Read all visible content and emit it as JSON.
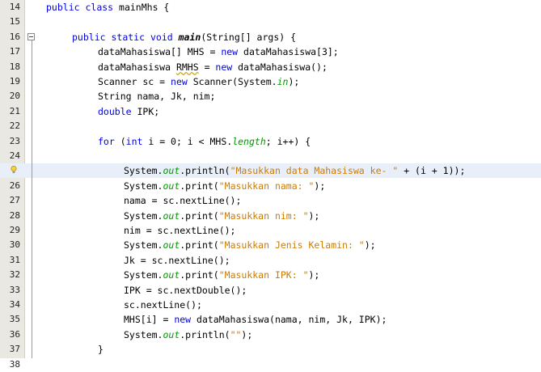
{
  "editor": {
    "lines": [
      {
        "n": "14",
        "indent": 0,
        "tokens": [
          {
            "t": "public",
            "c": "kw"
          },
          {
            "t": " "
          },
          {
            "t": "class",
            "c": "kw"
          },
          {
            "t": " mainMhs {"
          }
        ]
      },
      {
        "n": "15",
        "indent": 0,
        "tokens": []
      },
      {
        "n": "16",
        "indent": 1,
        "fold": true,
        "tokens": [
          {
            "t": "public",
            "c": "kw"
          },
          {
            "t": " "
          },
          {
            "t": "static",
            "c": "kw"
          },
          {
            "t": " "
          },
          {
            "t": "void",
            "c": "kw"
          },
          {
            "t": " "
          },
          {
            "t": "main",
            "c": "mth"
          },
          {
            "t": "(String[] args) {"
          }
        ]
      },
      {
        "n": "17",
        "indent": 2,
        "tokens": [
          {
            "t": "dataMahasiswa[] MHS = "
          },
          {
            "t": "new",
            "c": "kw"
          },
          {
            "t": " dataMahasiswa[3];"
          }
        ]
      },
      {
        "n": "18",
        "indent": 2,
        "tokens": [
          {
            "t": "dataMahasiswa "
          },
          {
            "t": "RMHS",
            "c": "warn"
          },
          {
            "t": " = "
          },
          {
            "t": "new",
            "c": "kw"
          },
          {
            "t": " dataMahasiswa();"
          }
        ]
      },
      {
        "n": "19",
        "indent": 2,
        "tokens": [
          {
            "t": "Scanner sc = "
          },
          {
            "t": "new",
            "c": "kw"
          },
          {
            "t": " Scanner(System."
          },
          {
            "t": "in",
            "c": "fld"
          },
          {
            "t": ");"
          }
        ]
      },
      {
        "n": "20",
        "indent": 2,
        "tokens": [
          {
            "t": "String nama, Jk, nim;"
          }
        ]
      },
      {
        "n": "21",
        "indent": 2,
        "tokens": [
          {
            "t": "double",
            "c": "kw"
          },
          {
            "t": " IPK;"
          }
        ]
      },
      {
        "n": "22",
        "indent": 0,
        "tokens": []
      },
      {
        "n": "23",
        "indent": 2,
        "tokens": [
          {
            "t": "for",
            "c": "kw"
          },
          {
            "t": " ("
          },
          {
            "t": "int",
            "c": "kw"
          },
          {
            "t": " i = 0; i < MHS."
          },
          {
            "t": "length",
            "c": "fld"
          },
          {
            "t": "; i++) {"
          }
        ]
      },
      {
        "n": "24",
        "indent": 0,
        "tokens": []
      },
      {
        "n": "25",
        "indent": 3,
        "highlight": true,
        "bulb": true,
        "tokens": [
          {
            "t": "System."
          },
          {
            "t": "out",
            "c": "fld"
          },
          {
            "t": ".println("
          },
          {
            "t": "\"Masukkan data Mahasiswa ke- \"",
            "c": "str"
          },
          {
            "t": " + (i + 1));"
          }
        ]
      },
      {
        "n": "26",
        "indent": 3,
        "tokens": [
          {
            "t": "System."
          },
          {
            "t": "out",
            "c": "fld"
          },
          {
            "t": ".print("
          },
          {
            "t": "\"Masukkan nama: \"",
            "c": "str"
          },
          {
            "t": ");"
          }
        ]
      },
      {
        "n": "27",
        "indent": 3,
        "tokens": [
          {
            "t": "nama = sc.nextLine();"
          }
        ]
      },
      {
        "n": "28",
        "indent": 3,
        "tokens": [
          {
            "t": "System."
          },
          {
            "t": "out",
            "c": "fld"
          },
          {
            "t": ".print("
          },
          {
            "t": "\"Masukkan nim: \"",
            "c": "str"
          },
          {
            "t": ");"
          }
        ]
      },
      {
        "n": "29",
        "indent": 3,
        "tokens": [
          {
            "t": "nim = sc.nextLine();"
          }
        ]
      },
      {
        "n": "30",
        "indent": 3,
        "tokens": [
          {
            "t": "System."
          },
          {
            "t": "out",
            "c": "fld"
          },
          {
            "t": ".print("
          },
          {
            "t": "\"Masukkan Jenis Kelamin: \"",
            "c": "str"
          },
          {
            "t": ");"
          }
        ]
      },
      {
        "n": "31",
        "indent": 3,
        "tokens": [
          {
            "t": "Jk = sc.nextLine();"
          }
        ]
      },
      {
        "n": "32",
        "indent": 3,
        "tokens": [
          {
            "t": "System."
          },
          {
            "t": "out",
            "c": "fld"
          },
          {
            "t": ".print("
          },
          {
            "t": "\"Masukkan IPK: \"",
            "c": "str"
          },
          {
            "t": ");"
          }
        ]
      },
      {
        "n": "33",
        "indent": 3,
        "tokens": [
          {
            "t": "IPK = sc.nextDouble();"
          }
        ]
      },
      {
        "n": "34",
        "indent": 3,
        "tokens": [
          {
            "t": "sc.nextLine();"
          }
        ]
      },
      {
        "n": "35",
        "indent": 3,
        "tokens": [
          {
            "t": "MHS[i] = "
          },
          {
            "t": "new",
            "c": "kw"
          },
          {
            "t": " dataMahasiswa(nama, nim, Jk, IPK);"
          }
        ]
      },
      {
        "n": "36",
        "indent": 3,
        "tokens": [
          {
            "t": "System."
          },
          {
            "t": "out",
            "c": "fld"
          },
          {
            "t": ".println("
          },
          {
            "t": "\"\"",
            "c": "str"
          },
          {
            "t": ");"
          }
        ]
      },
      {
        "n": "37",
        "indent": 2,
        "tokens": [
          {
            "t": "}"
          }
        ]
      },
      {
        "n": "38",
        "indent": 0,
        "tokens": []
      }
    ]
  },
  "colors": {
    "keyword": "#0000e6",
    "string": "#ce7b00",
    "field": "#009900",
    "highlight_line": "#e9eff8",
    "gutter": "#e9e8e2"
  },
  "icons": {
    "hint": "lightbulb-icon",
    "fold": "fold-collapse-icon"
  }
}
